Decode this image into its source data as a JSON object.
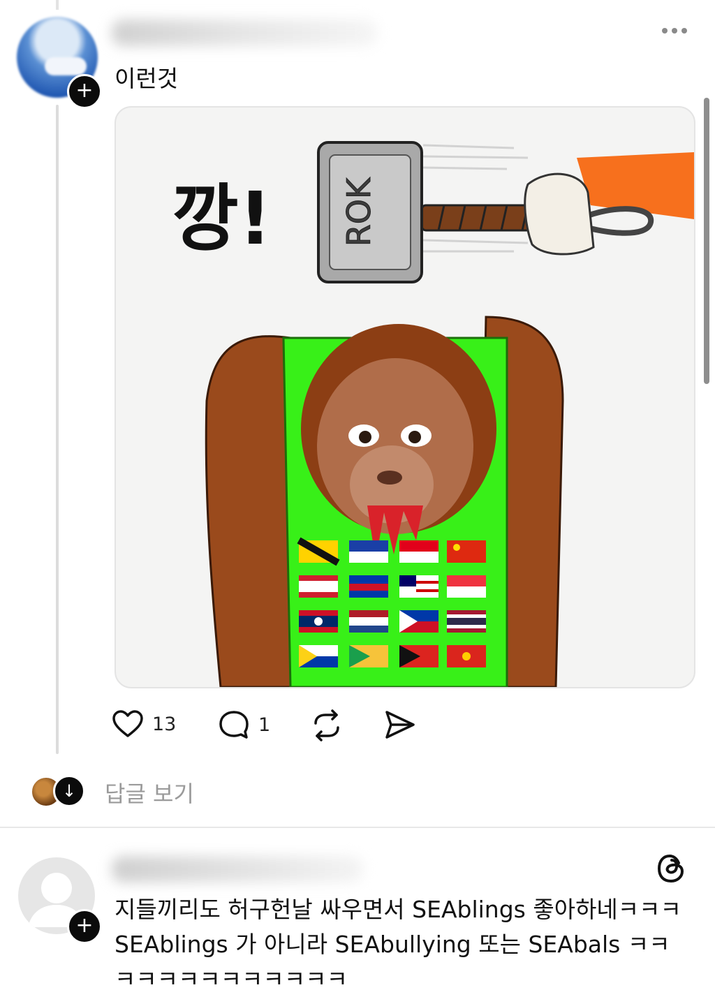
{
  "post1": {
    "text": "이런것",
    "more_icon": "more-horizontal-icon",
    "meme": {
      "sound_text": "깡!",
      "hammer_text": "ROK"
    },
    "actions": {
      "like_count": "13",
      "comment_count": "1"
    },
    "view_replies": "답글 보기"
  },
  "post2": {
    "lines": [
      "지들끼리도 허구헌날 싸우면서 SEAblings 좋아하네ㅋㅋㅋ",
      "SEAblings 가 아니라 SEAbullying 또는 SEAbals ㅋㅋ",
      "ㅋㅋㅋㅋㅋㅋㅋㅋㅋㅋㅋ"
    ]
  },
  "colors": {
    "vest_green": "#38f018",
    "arm_brown": "#9a4a1c",
    "beam_orange": "#f7701d"
  }
}
